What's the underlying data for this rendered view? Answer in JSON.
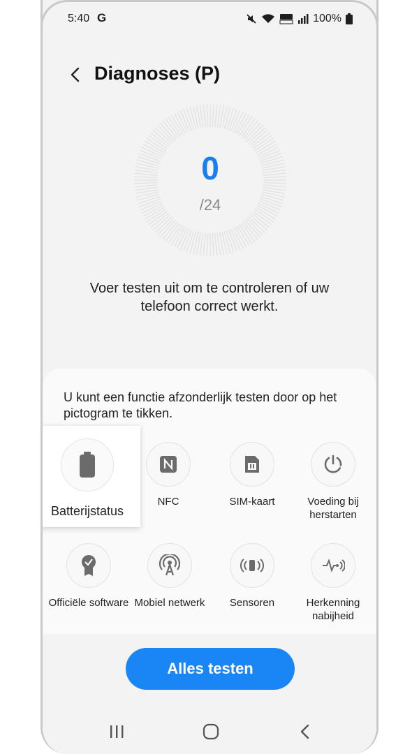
{
  "status": {
    "time": "5:40",
    "carrier_logo": "G",
    "battery_percent": "100%",
    "icons": [
      "mute-icon",
      "wifi-icon",
      "hd-voice-icon",
      "signal-icon",
      "battery-icon"
    ]
  },
  "header": {
    "title": "Diagnoses (P)"
  },
  "gauge": {
    "count": "0",
    "total": "/24",
    "progress": 0
  },
  "intro": "Voer testen uit om te controleren of uw telefoon correct werkt.",
  "panel": {
    "instruction": "U kunt een functie afzonderlijk testen door op het pictogram te tikken.",
    "tiles": [
      {
        "label": "Batterijstatus",
        "icon": "battery-icon"
      },
      {
        "label": "NFC",
        "icon": "nfc-icon"
      },
      {
        "label": "SIM-kaart",
        "icon": "sim-card-icon"
      },
      {
        "label": "Voeding bij herstarten",
        "icon": "power-restart-icon"
      },
      {
        "label": "Officiële software",
        "icon": "official-software-icon"
      },
      {
        "label": "Mobiel netwerk",
        "icon": "mobile-network-icon"
      },
      {
        "label": "Sensoren",
        "icon": "sensors-icon"
      },
      {
        "label": "Herkenning nabijheid",
        "icon": "proximity-icon"
      }
    ]
  },
  "actions": {
    "test_all": "Alles testen"
  },
  "colors": {
    "accent": "#1a86f5",
    "count": "#1a7ff0"
  }
}
